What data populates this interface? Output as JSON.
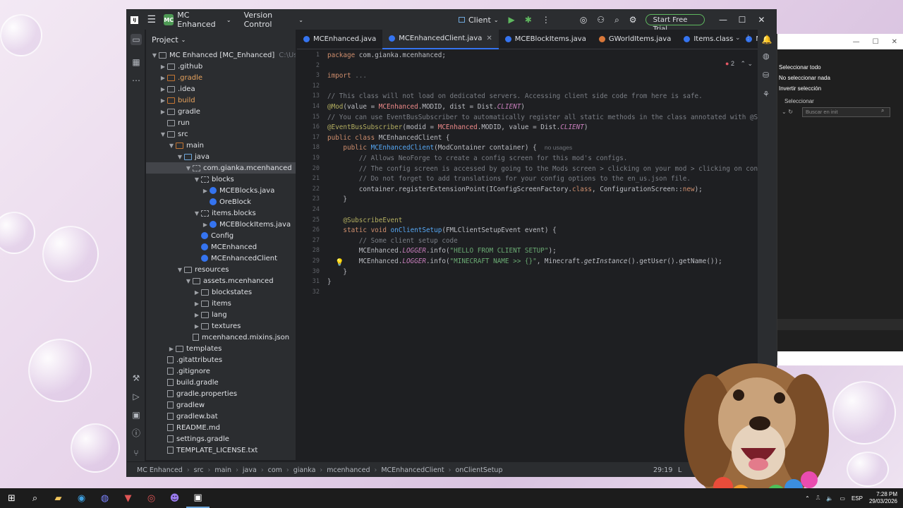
{
  "titlebar": {
    "project_badge": "MC",
    "project_name": "MC Enhanced",
    "vcs": "Version Control",
    "run_config": "Client",
    "trial_button": "Start Free Trial"
  },
  "project_panel": {
    "title": "Project",
    "tree": [
      {
        "label": "MC Enhanced [MC_Enhanced]",
        "extra": "C:\\Users\\G",
        "depth": 0,
        "arrow": "▼",
        "icon": "folder"
      },
      {
        "label": ".github",
        "depth": 1,
        "arrow": "▶",
        "icon": "folder"
      },
      {
        "label": ".gradle",
        "depth": 1,
        "arrow": "▶",
        "icon": "folder-orange",
        "color": "orange"
      },
      {
        "label": ".idea",
        "depth": 1,
        "arrow": "▶",
        "icon": "folder"
      },
      {
        "label": "build",
        "depth": 1,
        "arrow": "▶",
        "icon": "folder-orange",
        "color": "orange"
      },
      {
        "label": "gradle",
        "depth": 1,
        "arrow": "▶",
        "icon": "folder"
      },
      {
        "label": "run",
        "depth": 1,
        "arrow": "",
        "icon": "folder"
      },
      {
        "label": "src",
        "depth": 1,
        "arrow": "▼",
        "icon": "folder"
      },
      {
        "label": "main",
        "depth": 2,
        "arrow": "▼",
        "icon": "folder-orange"
      },
      {
        "label": "java",
        "depth": 3,
        "arrow": "▼",
        "icon": "folder-blue"
      },
      {
        "label": "com.gianka.mcenhanced",
        "depth": 4,
        "arrow": "▼",
        "icon": "package",
        "selected": true
      },
      {
        "label": "blocks",
        "depth": 5,
        "arrow": "▼",
        "icon": "package"
      },
      {
        "label": "MCEBlocks.java",
        "depth": 6,
        "arrow": "▶",
        "icon": "class"
      },
      {
        "label": "OreBlock",
        "depth": 6,
        "arrow": "",
        "icon": "class"
      },
      {
        "label": "items.blocks",
        "depth": 5,
        "arrow": "▼",
        "icon": "package"
      },
      {
        "label": "MCEBlockItems.java",
        "depth": 6,
        "arrow": "▶",
        "icon": "class"
      },
      {
        "label": "Config",
        "depth": 5,
        "arrow": "",
        "icon": "class"
      },
      {
        "label": "MCEnhanced",
        "depth": 5,
        "arrow": "",
        "icon": "class"
      },
      {
        "label": "MCEnhancedClient",
        "depth": 5,
        "arrow": "",
        "icon": "class"
      },
      {
        "label": "resources",
        "depth": 3,
        "arrow": "▼",
        "icon": "folder"
      },
      {
        "label": "assets.mcenhanced",
        "depth": 4,
        "arrow": "▼",
        "icon": "folder"
      },
      {
        "label": "blockstates",
        "depth": 5,
        "arrow": "▶",
        "icon": "folder"
      },
      {
        "label": "items",
        "depth": 5,
        "arrow": "▶",
        "icon": "folder"
      },
      {
        "label": "lang",
        "depth": 5,
        "arrow": "▶",
        "icon": "folder"
      },
      {
        "label": "textures",
        "depth": 5,
        "arrow": "▶",
        "icon": "folder"
      },
      {
        "label": "mcenhanced.mixins.json",
        "depth": 4,
        "arrow": "",
        "icon": "file"
      },
      {
        "label": "templates",
        "depth": 2,
        "arrow": "▶",
        "icon": "folder"
      },
      {
        "label": ".gitattributes",
        "depth": 1,
        "arrow": "",
        "icon": "file"
      },
      {
        "label": ".gitignore",
        "depth": 1,
        "arrow": "",
        "icon": "file"
      },
      {
        "label": "build.gradle",
        "depth": 1,
        "arrow": "",
        "icon": "file"
      },
      {
        "label": "gradle.properties",
        "depth": 1,
        "arrow": "",
        "icon": "file"
      },
      {
        "label": "gradlew",
        "depth": 1,
        "arrow": "",
        "icon": "file"
      },
      {
        "label": "gradlew.bat",
        "depth": 1,
        "arrow": "",
        "icon": "file"
      },
      {
        "label": "README.md",
        "depth": 1,
        "arrow": "",
        "icon": "file"
      },
      {
        "label": "settings.gradle",
        "depth": 1,
        "arrow": "",
        "icon": "file"
      },
      {
        "label": "TEMPLATE_LICENSE.txt",
        "depth": 1,
        "arrow": "",
        "icon": "file"
      }
    ]
  },
  "tabs": [
    {
      "label": "MCEnhanced.java",
      "icon": "class",
      "active": false
    },
    {
      "label": "MCEnhancedClient.java",
      "icon": "class",
      "active": true
    },
    {
      "label": "MCEBlockItems.java",
      "icon": "class",
      "active": false
    },
    {
      "label": "GWorldItems.java",
      "icon": "class-orange",
      "active": false
    },
    {
      "label": "Items.class",
      "icon": "class",
      "active": false
    },
    {
      "label": "MC",
      "icon": "class",
      "active": false
    }
  ],
  "editor": {
    "warnings": "2",
    "lines": [
      {
        "n": "1",
        "html": "<span class='kw'>package</span> com.gianka.mcenhanced;"
      },
      {
        "n": "2",
        "html": ""
      },
      {
        "n": "3",
        "html": "<span class='kw'>import</span> <span class='gray'>...</span>"
      },
      {
        "n": "12",
        "html": ""
      },
      {
        "n": "13",
        "html": "<span class='cm'>// This class will not load on dedicated servers. Accessing client side code from here is safe.</span>"
      },
      {
        "n": "14",
        "html": "<span class='an'>@Mod</span>(value = <span class='red'>MCEnhanced</span>.MODID, dist = Dist.<span class='st'>CLIENT</span>)"
      },
      {
        "n": "15",
        "html": "<span class='cm'>// You can use EventBusSubscriber to automatically register all static methods in the class annotated with @Subscr</span>"
      },
      {
        "n": "16",
        "html": "<span class='an'>@EventBusSubscriber</span>(modid = <span class='red'>MCEnhanced</span>.MODID, value = Dist.<span class='st'>CLIENT</span>)"
      },
      {
        "n": "17",
        "html": "<span class='kw'>public class</span> MCEnhancedClient {"
      },
      {
        "n": "18",
        "html": "    <span class='kw'>public</span> <span class='fn'>MCEnhancedClient</span>(ModContainer container) {  <span class='hint'>no usages</span>"
      },
      {
        "n": "19",
        "html": "        <span class='cm'>// Allows NeoForge to create a config screen for this mod's configs.</span>"
      },
      {
        "n": "20",
        "html": "        <span class='cm'>// The config screen is accessed by going to the Mods screen &gt; clicking on your mod &gt; clicking on config.</span>"
      },
      {
        "n": "21",
        "html": "        <span class='cm'>// Do not forget to add translations for your config options to the en_us.json file.</span>"
      },
      {
        "n": "22",
        "html": "        container.registerExtensionPoint(IConfigScreenFactory.<span class='kw'>class</span>, ConfigurationScreen::<span class='kw'>new</span>);"
      },
      {
        "n": "23",
        "html": "    }"
      },
      {
        "n": "24",
        "html": ""
      },
      {
        "n": "25",
        "html": "    <span class='an'>@SubscribeEvent</span>"
      },
      {
        "n": "26",
        "html": "    <span class='kw'>static void</span> <span class='fn'>onClientSetup</span>(FMLClientSetupEvent event) {"
      },
      {
        "n": "27",
        "html": "        <span class='cm'>// Some client setup code</span>"
      },
      {
        "n": "28",
        "html": "        MCEnhanced.<span class='st'>LOGGER</span>.info(<span class='str'>\"HELLO FROM CLIENT SETUP\"</span>);"
      },
      {
        "n": "29",
        "html": "        MCEnhanced.<span class='st'>LOGGER</span>.info(<span class='str'>\"MINECRAFT NAME &gt;&gt; {}\"</span>, Minecraft.<i>getInstance</i>().getUser().getName());"
      },
      {
        "n": "30",
        "html": "    }"
      },
      {
        "n": "31",
        "html": "}"
      },
      {
        "n": "32",
        "html": ""
      }
    ]
  },
  "statusbar": {
    "crumbs": [
      "MC Enhanced",
      "src",
      "main",
      "java",
      "com",
      "gianka",
      "mcenhanced",
      "MCEnhancedClient",
      "onClientSetup"
    ],
    "position": "29:19",
    "extra": "L"
  },
  "side_window": {
    "menu": [
      "Seleccionar todo",
      "No seleccionar nada",
      "Invertir selección"
    ],
    "section": "Seleccionar",
    "search_placeholder": "Buscar en init"
  },
  "taskbar": {
    "lang": "ESP",
    "time": "7:28 PM",
    "date": "29/03/2026"
  },
  "colors": {
    "accent": "#3574f0",
    "ide_bg": "#1e1f22",
    "panel_bg": "#2b2d30"
  }
}
